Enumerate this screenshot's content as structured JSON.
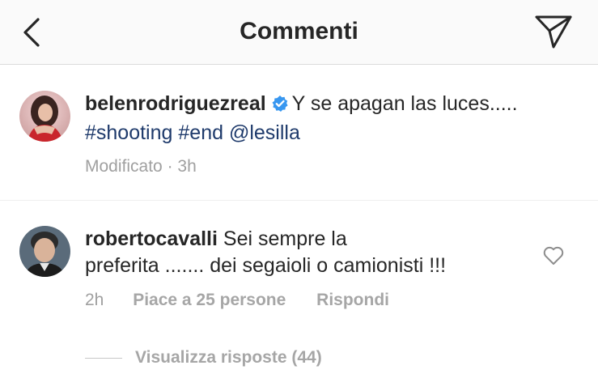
{
  "header": {
    "title": "Commenti",
    "back_icon": "chevron-left-icon",
    "share_icon": "paper-plane-icon"
  },
  "caption": {
    "username": "belenrodriguezreal",
    "verified": true,
    "text": "Y se apagan las luces.....",
    "hashtag_1": "#shooting",
    "hashtag_2": "#end",
    "mention": "@lesilla",
    "edited_label": "Modificato",
    "separator": "·",
    "time": "3h"
  },
  "comments": [
    {
      "username": "robertocavalli",
      "text_line_1": "Sei sempre la",
      "text_line_2": "preferita ....... dei segaioli o camionisti !!!",
      "time": "2h",
      "likes_label": "Piace a 25 persone",
      "reply_label": "Rispondi",
      "view_replies_label": "Visualizza risposte (44)"
    }
  ],
  "colors": {
    "text": "#262626",
    "muted": "#a0a0a0",
    "link": "#1e3a6b",
    "verified": "#3897f0",
    "header_bg": "#fafafa",
    "border": "#dbdbdb"
  }
}
